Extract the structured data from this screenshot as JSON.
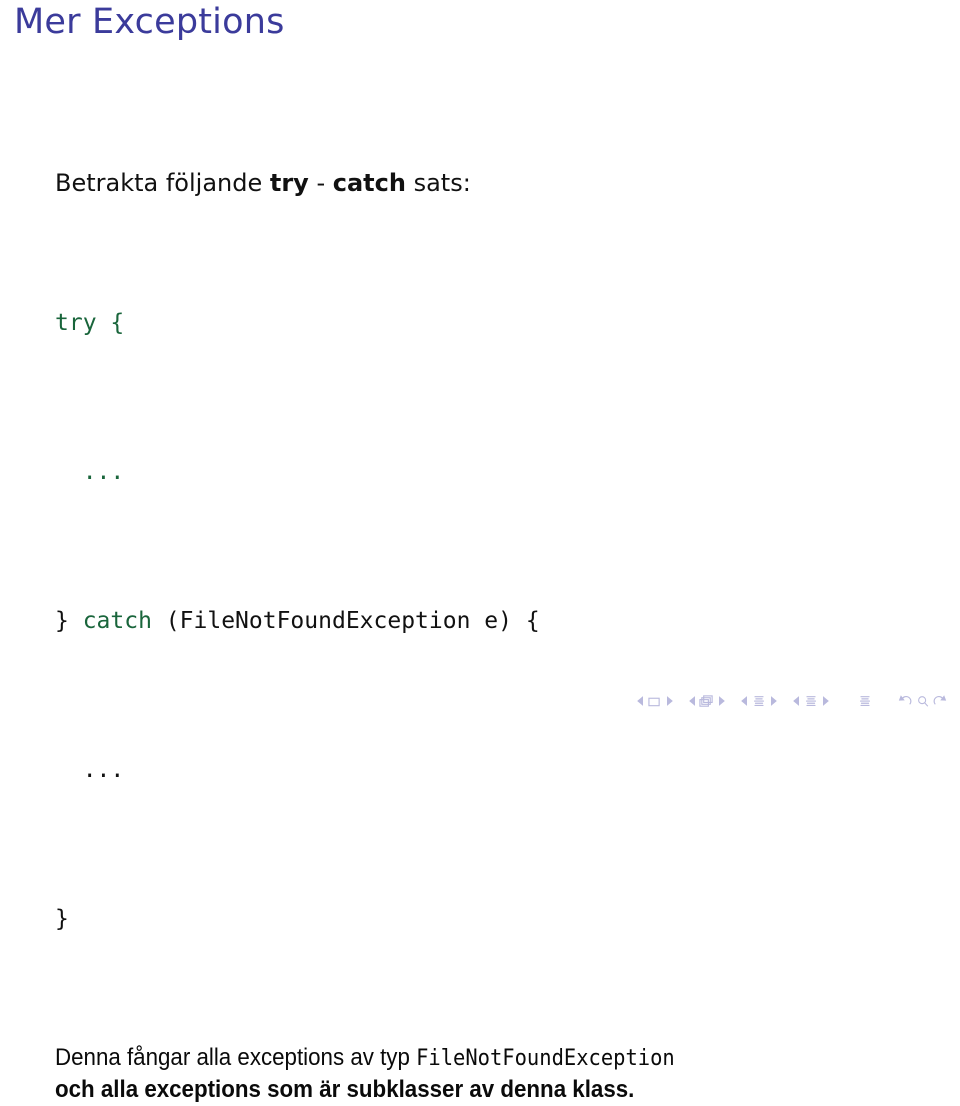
{
  "slide": {
    "title": "Mer Exceptions",
    "intro": {
      "before": "Betrakta följande ",
      "keyword_try": "try",
      "dash": " - ",
      "keyword_catch": "catch",
      "after": " sats:"
    },
    "code": {
      "language": "java",
      "lines": [
        {
          "keyword": "try",
          "rest": " {"
        },
        {
          "keyword": "",
          "rest": "  ...",
          "dots_colored": true
        },
        {
          "keyword": "catch",
          "prefix": "} ",
          "rest": " (FileNotFoundException e) {"
        },
        {
          "keyword": "",
          "rest": "  ..."
        },
        {
          "keyword": "",
          "rest": "}"
        }
      ],
      "line1": "try {",
      "line2": "  ...",
      "line3_prefix": "} ",
      "line3_keyword": "catch",
      "line3_rest": " (FileNotFoundException e) {",
      "line4": "  ...",
      "line5": "}"
    },
    "outro": {
      "line1_before": "Denna fångar alla exceptions av typ ",
      "line1_mono": "FileNotFoundException",
      "line2": "och alla exceptions som är subklasser av denna klass."
    }
  },
  "navigation": {
    "items": [
      {
        "name": "prev-frame",
        "glyph": "left-triangle"
      },
      {
        "name": "current-frame",
        "glyph": "frame-square"
      },
      {
        "name": "next-frame",
        "glyph": "right-triangle"
      },
      {
        "name": "prev-subsection-slide",
        "glyph": "left-triangle"
      },
      {
        "name": "frames-stack",
        "glyph": "stacked-frames"
      },
      {
        "name": "next-subsection-slide",
        "glyph": "right-triangle"
      },
      {
        "name": "prev-subsection",
        "glyph": "left-triangle"
      },
      {
        "name": "subsection-doc",
        "glyph": "document-lines"
      },
      {
        "name": "next-subsection",
        "glyph": "right-triangle"
      },
      {
        "name": "prev-section",
        "glyph": "left-triangle"
      },
      {
        "name": "section-doc",
        "glyph": "document-lines"
      },
      {
        "name": "next-section",
        "glyph": "right-triangle"
      },
      {
        "name": "presentation-doc",
        "glyph": "document-lines"
      },
      {
        "name": "back",
        "glyph": "counterclockwise-arrow"
      },
      {
        "name": "search",
        "glyph": "magnifier"
      },
      {
        "name": "forward",
        "glyph": "clockwise-arrow"
      }
    ]
  },
  "colors": {
    "title": "#3b3b9b",
    "keyword_green": "#19653b",
    "text": "#111111",
    "nav": "#b9b9dd",
    "background": "#ffffff"
  }
}
